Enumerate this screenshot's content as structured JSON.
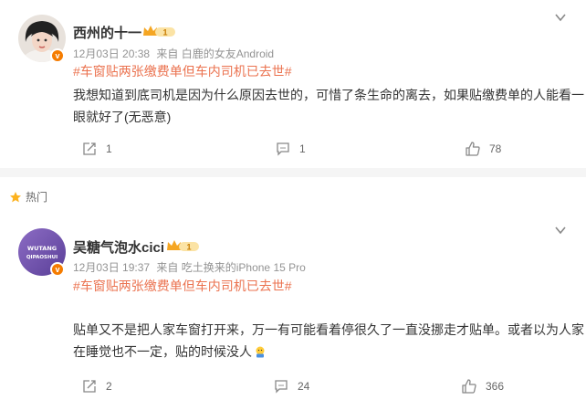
{
  "post1": {
    "username": "西州的十一",
    "level": "1",
    "date": "12月03日 20:38",
    "source": "来自 白鹿的女友Android",
    "hashtag": "#车窗贴两张缴费单但车内司机已去世#",
    "content": "我想知道到底司机是因为什么原因去世的，可惜了条生命的离去，如果贴缴费单的人能看一眼就好了(无恶意)",
    "share_count": "1",
    "comment_count": "1",
    "like_count": "78"
  },
  "hot_label": "热门",
  "post2": {
    "username": "吴糖气泡水cici",
    "level": "1",
    "avatar_text_line1": "WUTANG",
    "avatar_text_line2": "QIPAOSHUI",
    "date": "12月03日 19:37",
    "source": "来自 吃土换来的iPhone 15 Pro",
    "hashtag": "#车窗贴两张缴费单但车内司机已去世#",
    "content": "贴单又不是把人家车窗打开来，万一有可能看着停很久了一直没挪走才贴单。或者以为人家在睡觉也不一定，贴的时候没人",
    "share_count": "2",
    "comment_count": "24",
    "like_count": "366"
  },
  "colors": {
    "accent": "#eb7350",
    "meta": "#939393",
    "vip_badge": "#f57c00",
    "hot_star": "#fcb21f"
  }
}
